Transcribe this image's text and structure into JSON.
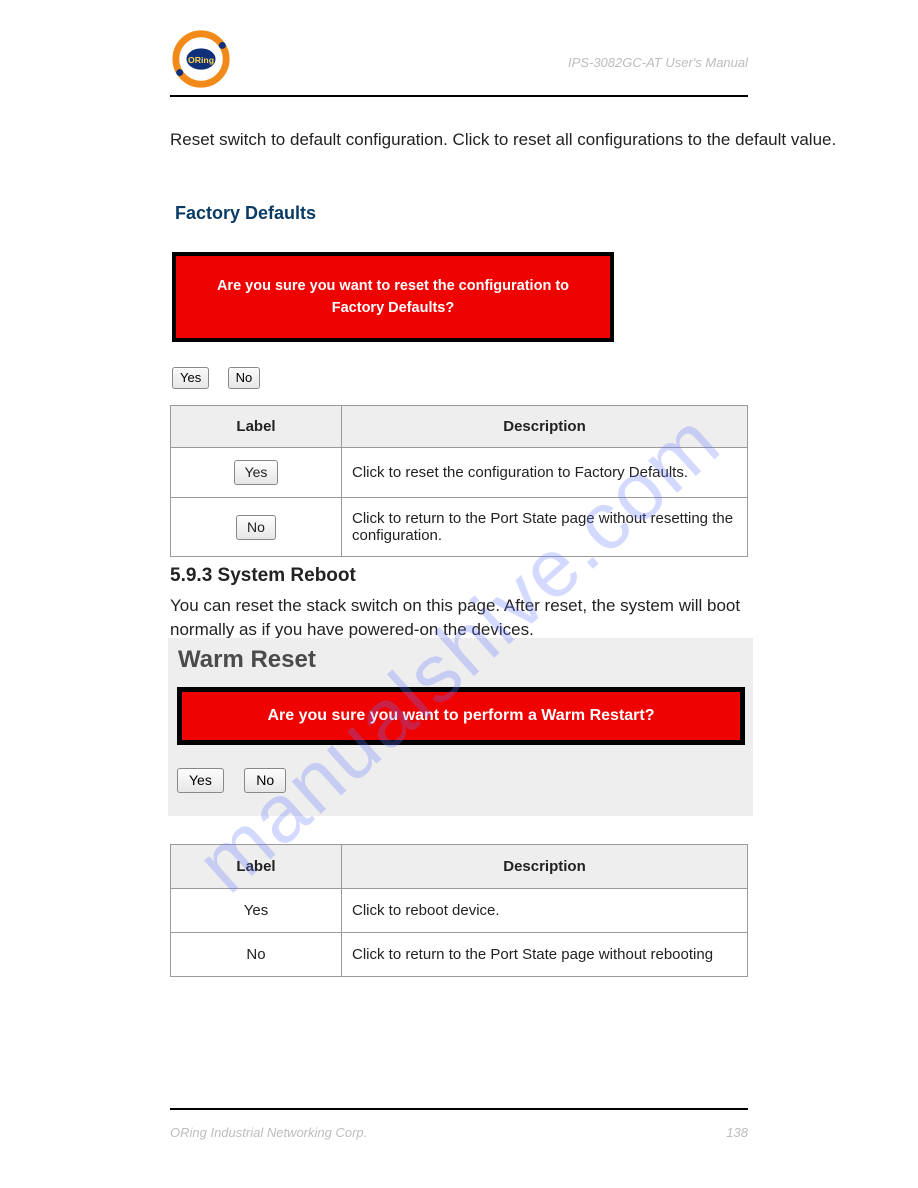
{
  "header": {
    "right_text": "IPS-3082GC-AT User's Manual"
  },
  "watermark": "manualshive.com",
  "section1": {
    "intro": "Reset switch to default configuration. Click  to reset all configurations to the default value.",
    "title": "Factory Defaults",
    "red_line1": "Are you sure you want to reset the configuration to",
    "red_line2": "Factory Defaults?",
    "btn_yes": "Yes",
    "btn_no": "No",
    "table": {
      "h1": "Label",
      "h2": "Description",
      "rows": [
        {
          "btn": "Yes",
          "desc": "Click  to reset the configuration to Factory Defaults."
        },
        {
          "btn": "No",
          "desc": "Click to return to the Port State page without resetting the configuration."
        }
      ]
    }
  },
  "section2": {
    "heading": "5.9.3 System Reboot",
    "desc": "You can reset the stack switch on this page. After reset, the system will boot normally as if you have powered-on the devices.",
    "panel_title": "Warm Reset",
    "red_text": "Are you sure you want to perform a Warm Restart?",
    "btn_yes": "Yes",
    "btn_no": "No",
    "table": {
      "h1": "Label",
      "h2": "Description",
      "rows": [
        {
          "btn": "Yes",
          "desc": "Click  to reboot device."
        },
        {
          "btn": "No",
          "desc": "Click to return to the Port State page without rebooting"
        }
      ]
    }
  },
  "footer": {
    "left": "ORing Industrial Networking Corp.",
    "right": "138"
  }
}
